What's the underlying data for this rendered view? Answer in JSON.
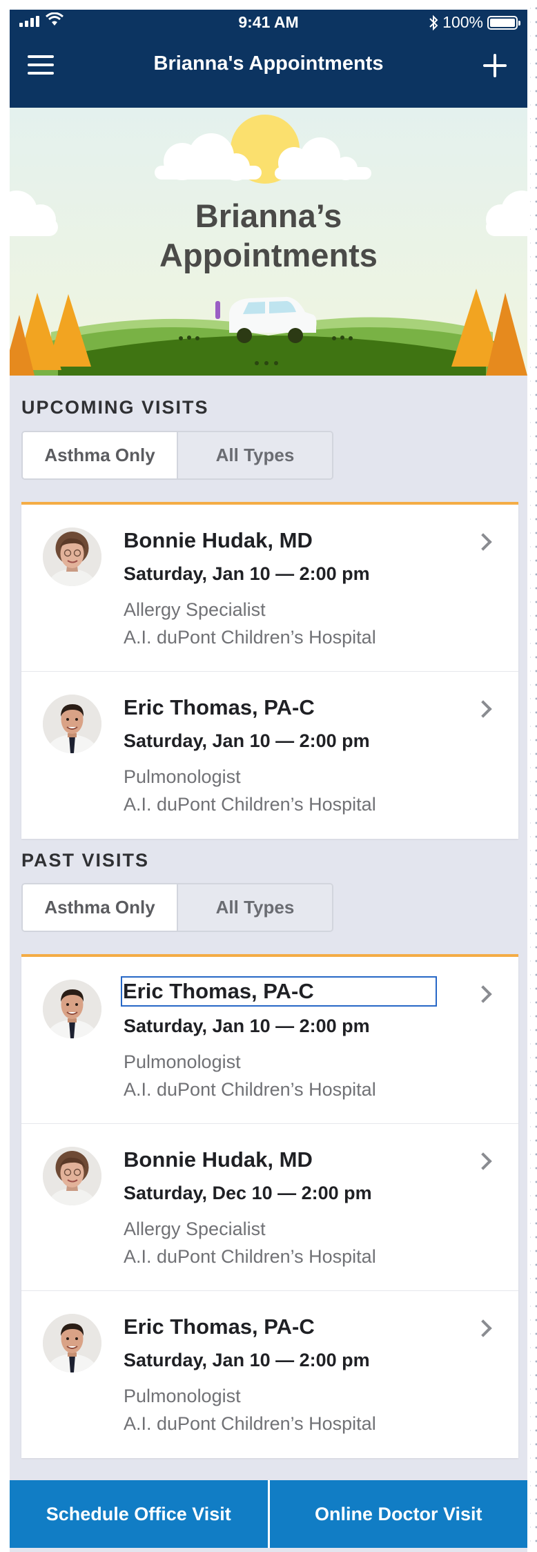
{
  "status_bar": {
    "time": "9:41 AM",
    "battery": "100%",
    "icons": [
      "signal-icon",
      "wifi-icon",
      "bluetooth-icon",
      "battery-icon"
    ]
  },
  "nav": {
    "title": "Brianna's Appointments",
    "menu_icon": "hamburger-menu-icon",
    "add_icon": "plus-icon"
  },
  "hero": {
    "title_line1": "Brianna’s",
    "title_line2": "Appointments"
  },
  "upcoming": {
    "heading": "UPCOMING VISITS",
    "filter": {
      "options": [
        "Asthma Only",
        "All Types"
      ],
      "selected": "Asthma Only"
    },
    "visits": [
      {
        "name": "Bonnie Hudak, MD",
        "date": "Saturday, Jan 10 — 2:00 pm",
        "specialty": "Allergy Specialist",
        "hospital": "A.I. duPont Children’s Hospital"
      },
      {
        "name": "Eric Thomas, PA-C",
        "date": "Saturday, Jan 10 — 2:00 pm",
        "specialty": "Pulmonologist",
        "hospital": "A.I. duPont Children’s Hospital"
      }
    ]
  },
  "past": {
    "heading": "PAST VISITS",
    "filter": {
      "options": [
        "Asthma Only",
        "All Types"
      ],
      "selected": "Asthma Only"
    },
    "visits": [
      {
        "name": "Eric Thomas, PA-C",
        "date": "Saturday, Jan 10 — 2:00 pm",
        "specialty": "Pulmonologist",
        "hospital": "A.I. duPont Children’s Hospital"
      },
      {
        "name": "Bonnie Hudak, MD",
        "date": "Saturday, Dec 10 — 2:00 pm",
        "specialty": "Allergy Specialist",
        "hospital": "A.I. duPont Children’s Hospital"
      },
      {
        "name": "Eric Thomas, PA-C",
        "date": "Saturday, Jan 10 — 2:00 pm",
        "specialty": "Pulmonologist",
        "hospital": "A.I. duPont Children’s Hospital"
      }
    ]
  },
  "actions": {
    "schedule_label": "Schedule Office Visit",
    "online_label": "Online Doctor Visit"
  },
  "colors": {
    "nav_bg": "#0c3461",
    "accent_orange": "#f4ac45",
    "button_blue": "#117dc5",
    "page_bg": "#e3e5ee"
  }
}
